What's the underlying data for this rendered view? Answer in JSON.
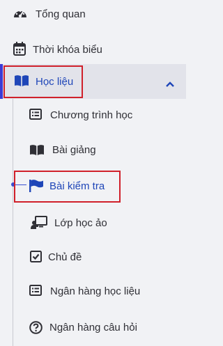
{
  "menu": {
    "overview": {
      "label": "Tổng quan",
      "icon": "speedometer-icon"
    },
    "timetable": {
      "label": "Thời khóa biểu",
      "icon": "calendar-icon"
    },
    "learning": {
      "label": "Học liệu",
      "icon": "book-open-icon",
      "expanded": true,
      "children": [
        {
          "label": "Chương trình học",
          "icon": "list-icon"
        },
        {
          "label": "Bài giảng",
          "icon": "book-icon"
        },
        {
          "label": "Bài kiểm tra",
          "icon": "flag-icon",
          "active": true
        },
        {
          "label": "Lớp học ảo",
          "icon": "presentation-icon"
        },
        {
          "label": "Chủ đề",
          "icon": "checkbox-icon"
        },
        {
          "label": "Ngân hàng học liệu",
          "icon": "list-icon"
        },
        {
          "label": "Ngân hàng câu hỏi",
          "icon": "question-circle-icon"
        }
      ]
    }
  },
  "colors": {
    "accent": "#1f46b8",
    "highlight_box": "#d0202a",
    "background": "#f1f2f5",
    "active_background": "#e2e3ea"
  }
}
